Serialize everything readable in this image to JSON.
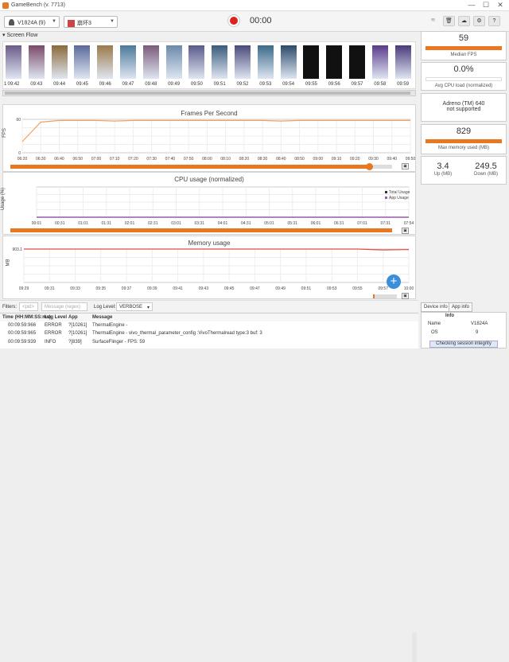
{
  "app": {
    "title": "GameBench (v. 7713)",
    "window_controls": [
      "—",
      "☐",
      "✕"
    ]
  },
  "toolbar": {
    "device": "V1824A (9)",
    "app_name": "崩坏3",
    "timer": "00:00",
    "icons": [
      "wifi-icon",
      "trash-icon",
      "cloud-upload-icon",
      "settings-icon",
      "help-icon"
    ]
  },
  "screen_flow": {
    "label": "Screen Flow",
    "frames": [
      {
        "time": "09:42"
      },
      {
        "time": "09:43"
      },
      {
        "time": "09:44"
      },
      {
        "time": "09:45"
      },
      {
        "time": "09:46"
      },
      {
        "time": "09:47"
      },
      {
        "time": "09:48"
      },
      {
        "time": "09:49"
      },
      {
        "time": "09:50"
      },
      {
        "time": "09:51"
      },
      {
        "time": "09:52"
      },
      {
        "time": "09:53"
      },
      {
        "time": "09:54"
      },
      {
        "time": "09:55"
      },
      {
        "time": "09:56"
      },
      {
        "time": "09:57"
      },
      {
        "time": "09:58"
      },
      {
        "time": "09:59"
      }
    ],
    "first_index": "1"
  },
  "charts": [
    {
      "type": "line",
      "title": "Frames Per Second",
      "ylabel": "FPS",
      "yticks": [
        "60",
        "0"
      ],
      "categories": [
        "06:20",
        "06:30",
        "06:40",
        "06:50",
        "07:00",
        "07:10",
        "07:20",
        "07:30",
        "07:40",
        "07:50",
        "08:00",
        "08:10",
        "08:20",
        "08:30",
        "08:40",
        "08:50",
        "09:00",
        "09:10",
        "09:20",
        "09:30",
        "09:40",
        "09:50"
      ],
      "series": [
        {
          "color": "#f0a060",
          "values": [
            20,
            55,
            58,
            58,
            58,
            57,
            58,
            58,
            58,
            58,
            58,
            58,
            58,
            58,
            57,
            58,
            58,
            58,
            58,
            58,
            58,
            58
          ]
        }
      ],
      "ylim": [
        0,
        60
      ],
      "slider_fraction": 0.94
    },
    {
      "type": "line",
      "title": "CPU usage (normalized)",
      "ylabel": "Usage (%)",
      "categories": [
        "00:01",
        "00:31",
        "01:01",
        "01:31",
        "02:01",
        "02:31",
        "03:01",
        "03:31",
        "04:01",
        "04:31",
        "05:01",
        "05:31",
        "06:01",
        "06:31",
        "07:01",
        "07:31",
        "07:54"
      ],
      "series": [
        {
          "name": "Total Usage",
          "color": "#333333",
          "values": [
            0,
            0,
            0,
            0,
            0,
            0,
            0,
            0,
            0,
            0,
            0,
            0,
            0,
            0,
            0,
            0,
            0
          ]
        },
        {
          "name": "App Usage",
          "color": "#9b59b6",
          "values": [
            0,
            0,
            0,
            0,
            0,
            0,
            0,
            0,
            0,
            0,
            0,
            0,
            0,
            0,
            0,
            0,
            0
          ]
        }
      ],
      "ylim": [
        0,
        100
      ],
      "slider_fraction": 1.0
    },
    {
      "type": "line",
      "title": "Memory usage",
      "ylabel": "MB",
      "yticks": [
        "903.1"
      ],
      "categories": [
        "09:29",
        "09:31",
        "09:33",
        "09:35",
        "09:37",
        "09:39",
        "09:41",
        "09:43",
        "09:45",
        "09:47",
        "09:49",
        "09:51",
        "09:53",
        "09:55",
        "09:57",
        "10:00"
      ],
      "series": [
        {
          "color": "#e74c3c",
          "values": [
            903,
            903,
            903,
            903,
            903,
            903,
            903,
            903,
            903,
            903,
            903,
            903,
            903,
            903,
            880,
            890
          ]
        }
      ],
      "ylim": [
        0,
        903.1
      ],
      "slider_fraction": 0.06
    }
  ],
  "stats": {
    "median_fps": "59",
    "median_fps_label": "Median FPS",
    "cpu": "0.0%",
    "cpu_label": "Avg CPU load (normalized)",
    "gpu_line1": "Adreno (TM) 640",
    "gpu_line2": "not supported",
    "mem": "829",
    "mem_label": "Max memory used (MB)",
    "up": "3.4",
    "up_label": "Up (MB)",
    "down": "249.5",
    "down_label": "Down (MB)"
  },
  "filters": {
    "label": "Filters:",
    "pid_placeholder": "<pid>",
    "msg_placeholder": "Message (regex)",
    "level_label": "Log Level:",
    "level": "VERBOSE"
  },
  "log": {
    "headers": [
      "Time (HH:MM:SS:ms)",
      "Log Level",
      "App",
      "Message"
    ],
    "rows": [
      {
        "time": "00:09:59:966",
        "level": "ERROR",
        "app": "?[10261]",
        "msg": "ThermalEngine -"
      },
      {
        "time": "00:09:59:965",
        "level": "ERROR",
        "app": "?[10261]",
        "msg": "ThermalEngine - vivo_thermal_parameter_config :VivoThermalread type:3  buf: 3"
      },
      {
        "time": "00:09:59:939",
        "level": "INFO",
        "app": "?[839]",
        "msg": "SurfaceFlinger - FPS: 59"
      }
    ]
  },
  "device_tabs": [
    "Device info",
    "App info"
  ],
  "device_info": {
    "header": "Info",
    "name_label": "Name",
    "name": "V1824A",
    "os_label": "OS",
    "os": "9",
    "status": "Checking session integrity"
  }
}
